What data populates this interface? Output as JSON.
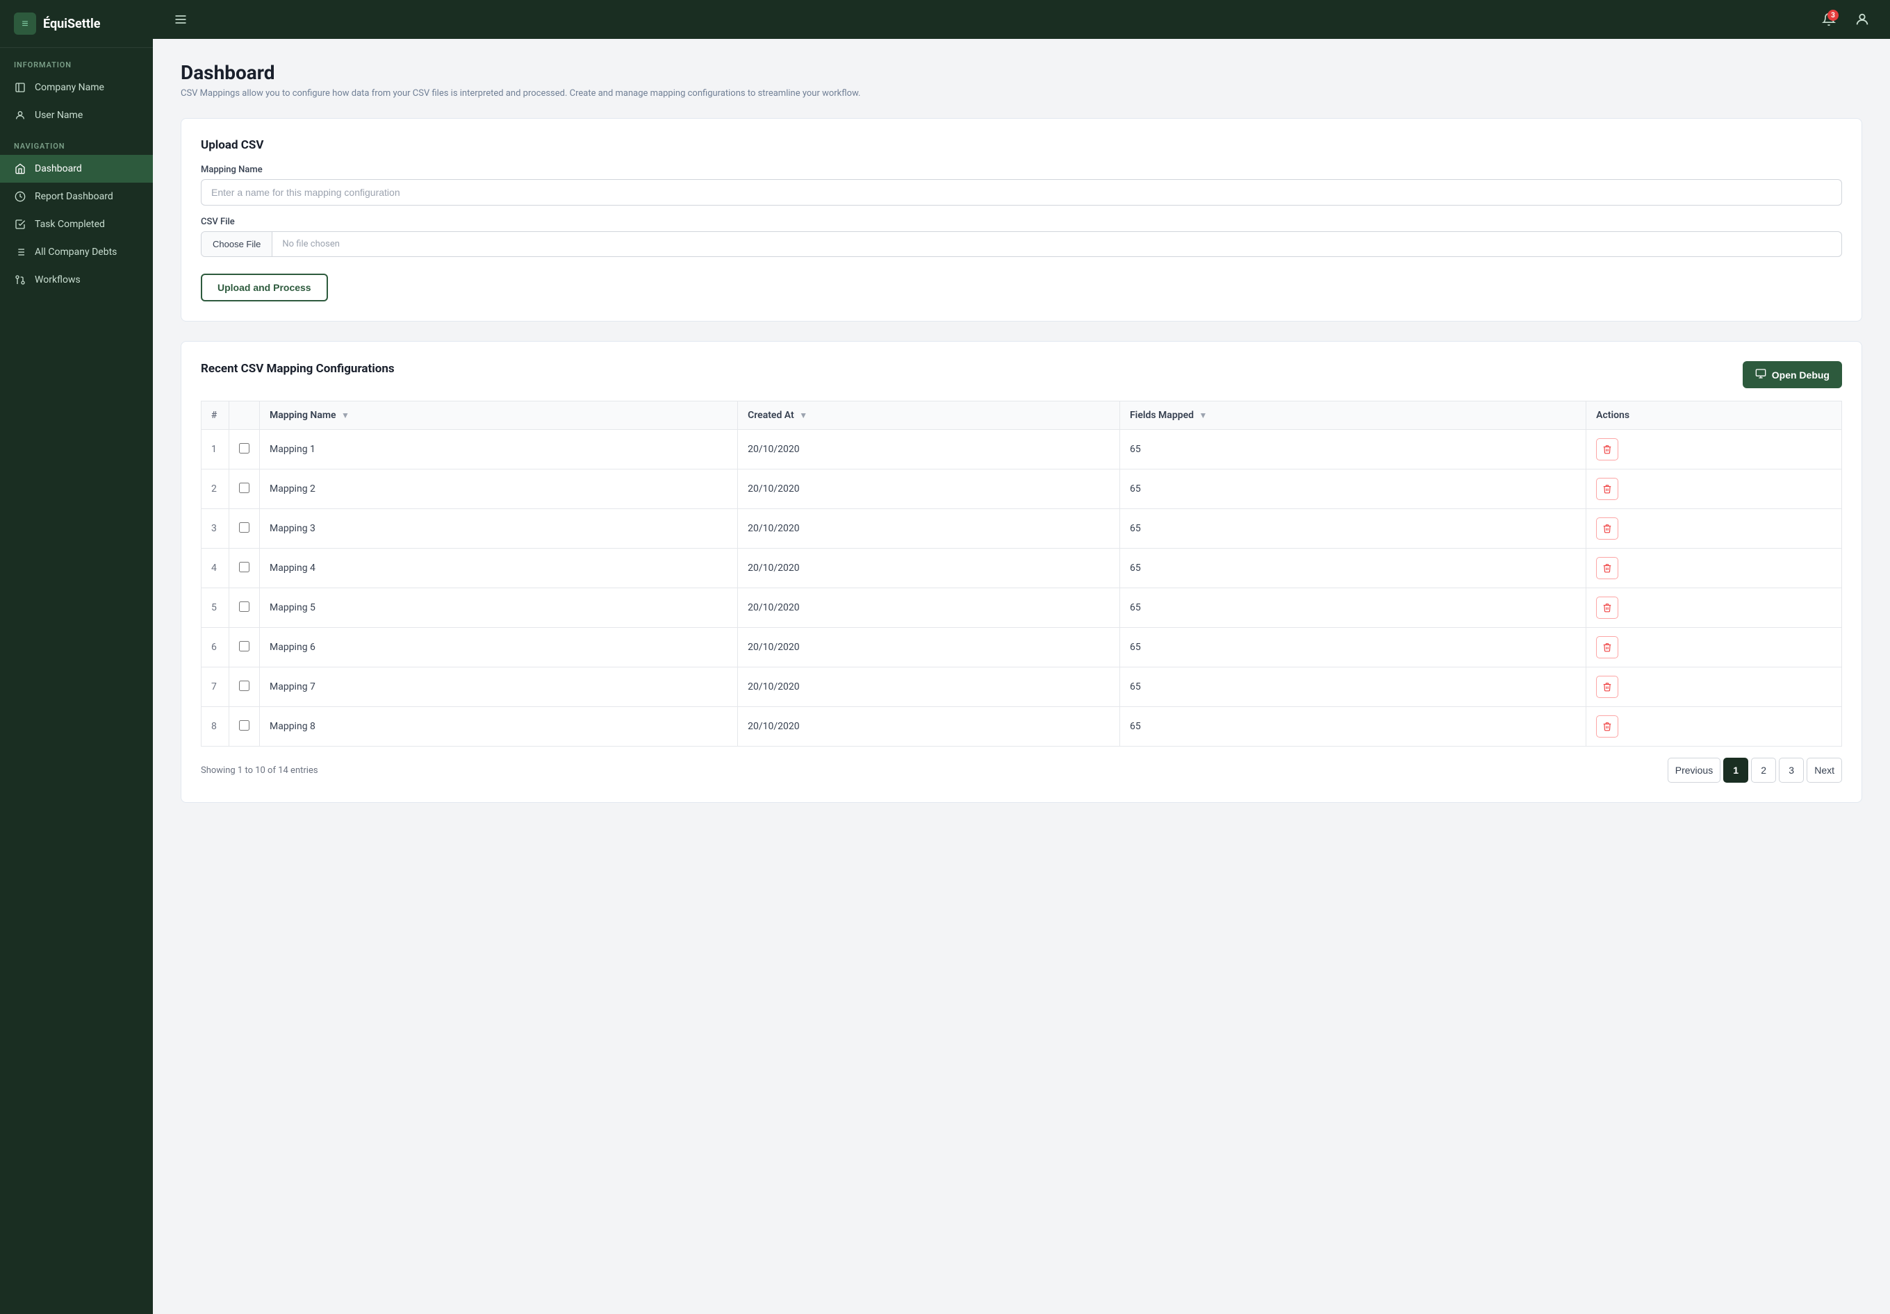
{
  "brand": {
    "logo_letter": "≡",
    "name": "ÉquiSettle"
  },
  "sidebar": {
    "info_label": "Information",
    "nav_label": "Navigation",
    "items_info": [
      {
        "id": "company",
        "label": "Company Name",
        "icon": "building"
      },
      {
        "id": "user",
        "label": "User Name",
        "icon": "user"
      }
    ],
    "items_nav": [
      {
        "id": "dashboard",
        "label": "Dashboard",
        "icon": "home",
        "active": true
      },
      {
        "id": "report",
        "label": "Report Dashboard",
        "icon": "chart"
      },
      {
        "id": "tasks",
        "label": "Task Completed",
        "icon": "check-square"
      },
      {
        "id": "debts",
        "label": "All Company Debts",
        "icon": "list"
      },
      {
        "id": "workflows",
        "label": "Workflows",
        "icon": "workflow"
      }
    ]
  },
  "topbar": {
    "menu_icon": "☰",
    "notification_count": "3",
    "user_icon": "👤"
  },
  "page": {
    "title": "Dashboard",
    "description": "CSV Mappings allow you to configure how data from your CSV files is interpreted and processed. Create and manage mapping configurations to streamline your workflow."
  },
  "upload_section": {
    "title": "Upload CSV",
    "mapping_name_label": "Mapping Name",
    "mapping_name_placeholder": "Enter a name for this mapping configuration",
    "csv_file_label": "CSV File",
    "choose_file_btn": "Choose File",
    "no_file_text": "No file chosen",
    "upload_btn": "Upload and Process"
  },
  "table_section": {
    "title": "Recent CSV Mapping Configurations",
    "debug_btn": "Open Debug",
    "columns": [
      "#",
      "",
      "Mapping Name",
      "Created At",
      "Fields Mapped",
      "Actions"
    ],
    "rows": [
      {
        "num": 1,
        "name": "Mapping 1",
        "created_at": "20/10/2020",
        "fields": 65
      },
      {
        "num": 2,
        "name": "Mapping 2",
        "created_at": "20/10/2020",
        "fields": 65
      },
      {
        "num": 3,
        "name": "Mapping 3",
        "created_at": "20/10/2020",
        "fields": 65
      },
      {
        "num": 4,
        "name": "Mapping 4",
        "created_at": "20/10/2020",
        "fields": 65
      },
      {
        "num": 5,
        "name": "Mapping 5",
        "created_at": "20/10/2020",
        "fields": 65
      },
      {
        "num": 6,
        "name": "Mapping 6",
        "created_at": "20/10/2020",
        "fields": 65
      },
      {
        "num": 7,
        "name": "Mapping 7",
        "created_at": "20/10/2020",
        "fields": 65
      },
      {
        "num": 8,
        "name": "Mapping 8",
        "created_at": "20/10/2020",
        "fields": 65
      }
    ],
    "pagination": {
      "info": "Showing 1 to 10 of 14 entries",
      "prev": "Previous",
      "next": "Next",
      "pages": [
        1,
        2,
        3
      ],
      "active_page": 1
    }
  }
}
